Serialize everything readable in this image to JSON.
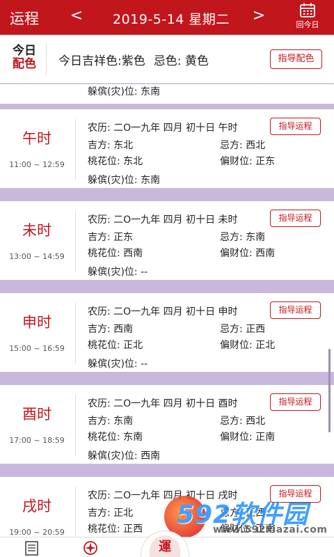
{
  "header": {
    "title": "运程",
    "prev": "<",
    "date": "2019-5-14  星期二",
    "next": ">",
    "today_label": "回今日",
    "calendar_day": "1"
  },
  "color_bar": {
    "logo_line1": "今日",
    "logo_line2": "配色",
    "lucky_color": "今日吉祥色:紫色",
    "avoid_color": "忌色: 黄色",
    "button": "指导配色"
  },
  "partial_prev": {
    "disaster": "躲傧(灾)位: 东南"
  },
  "hours": [
    {
      "name": "午时",
      "range": "11:00 ~ 12:59",
      "lunar": "农历: 二O一九年 四月 初十日 午时",
      "lucky": "吉方: 东北",
      "avoid": "忌方: 西北",
      "peach": "桃花位: 东北",
      "wealth": "偏财位: 正东",
      "disaster": "躲傧(灾)位: 东南",
      "button": "指导运程"
    },
    {
      "name": "未时",
      "range": "13:00 ~ 14:59",
      "lunar": "农历: 二O一九年 四月 初十日 未时",
      "lucky": "吉方: 正东",
      "avoid": "忌方: 东南",
      "peach": "桃花位: 西南",
      "wealth": "偏财位: 西南",
      "disaster": "躲傧(灾)位: --",
      "button": "指导运程"
    },
    {
      "name": "申时",
      "range": "15:00 ~ 16:59",
      "lunar": "农历: 二O一九年 四月 初十日 申时",
      "lucky": "吉方: 西南",
      "avoid": "忌方: 正西",
      "peach": "桃花位: 正北",
      "wealth": "偏财位: 正北",
      "disaster": "躲傧(灾)位: --",
      "button": "指导运程"
    },
    {
      "name": "酉时",
      "range": "17:00 ~ 18:59",
      "lunar": "农历: 二O一九年 四月 初十日 酉时",
      "lucky": "吉方: 东南",
      "avoid": "忌方: 西北",
      "peach": "桃花位: 东南",
      "wealth": "偏财位: 正南",
      "disaster": "躲傧(灾)位: 西南",
      "button": "指导运程"
    },
    {
      "name": "戌时",
      "range": "19:00 ~ 20:59",
      "lunar": "农历: 二O一九年 四月 初十日 戌时",
      "lucky": "吉方: 正北",
      "avoid": "忌方: 正西",
      "peach": "桃花位: 正西",
      "wealth": "偏财位: 正南",
      "disaster": "",
      "button": "指导运程"
    }
  ],
  "bottom": {
    "center_label": "運"
  },
  "watermark": {
    "brand": "592软件园",
    "url": "www.592xiazai.com"
  },
  "colors": {
    "accent": "#c2161d",
    "divider": "#c8b9dc"
  }
}
